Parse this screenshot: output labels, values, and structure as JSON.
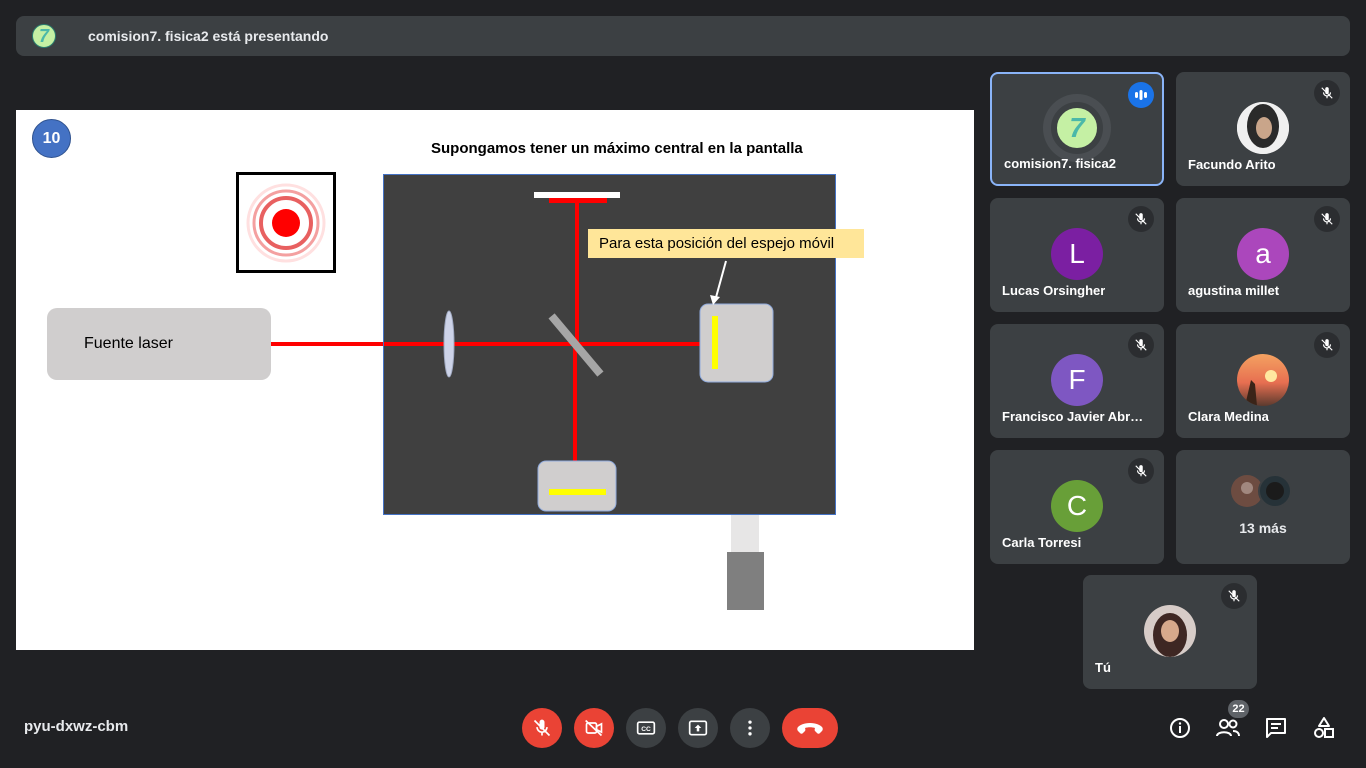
{
  "banner": {
    "avatar_letter": "7",
    "text": "comision7. fisica2 está presentando"
  },
  "slide": {
    "number": "10",
    "title": "Supongamos tener un máximo central en la pantalla",
    "source_label": "Fuente  laser",
    "callout": "Para esta posición del espejo móvil"
  },
  "participants": [
    {
      "name": "comision7. fisica2",
      "avatar": "7",
      "color": "#c5f0a4",
      "speaking": true
    },
    {
      "name": "Facundo Arito",
      "avatar": "",
      "color": "#e0e0e0",
      "muted": true
    },
    {
      "name": "Lucas Orsingher",
      "avatar": "L",
      "color": "#7b1fa2",
      "muted": true
    },
    {
      "name": "agustina millet",
      "avatar": "a",
      "color": "#ab47bc",
      "muted": true
    },
    {
      "name": "Francisco Javier Abr…",
      "avatar": "F",
      "color": "#7e57c2",
      "muted": true
    },
    {
      "name": "Clara Medina",
      "avatar": "",
      "color": "#d2691e",
      "muted": true
    },
    {
      "name": "Carla Torresi",
      "avatar": "C",
      "color": "#689f38",
      "muted": true
    },
    {
      "name": "13 más"
    },
    {
      "name": "Tú",
      "avatar": "",
      "color": "#5d4037",
      "muted": true
    }
  ],
  "footer": {
    "meeting_code": "pyu-dxwz-cbm",
    "participant_count": "22"
  }
}
